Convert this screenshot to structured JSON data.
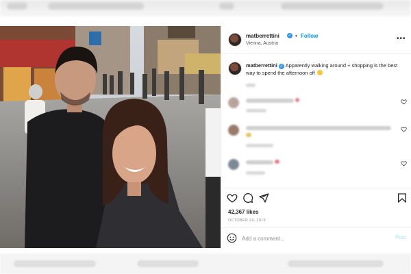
{
  "post": {
    "username": "matberrettini",
    "follow_separator": "•",
    "follow_label": "Follow",
    "location": "Vienna, Austria",
    "more_label": "•••",
    "caption": "Apparently walking around + shopping is the best way to spend the afternoon off",
    "likes": "42,367 likes",
    "date": "OCTOBER 24, 2019"
  },
  "composer": {
    "placeholder": "Add a comment...",
    "post_label": "Post"
  },
  "colors": {
    "accent": "#0095f6",
    "verified": "#3897f0",
    "heart": "#ed4956"
  },
  "icons": [
    "verified-badge-icon",
    "more-options-icon",
    "heart-icon",
    "comment-icon",
    "share-icon",
    "bookmark-icon",
    "emoji-icon"
  ]
}
